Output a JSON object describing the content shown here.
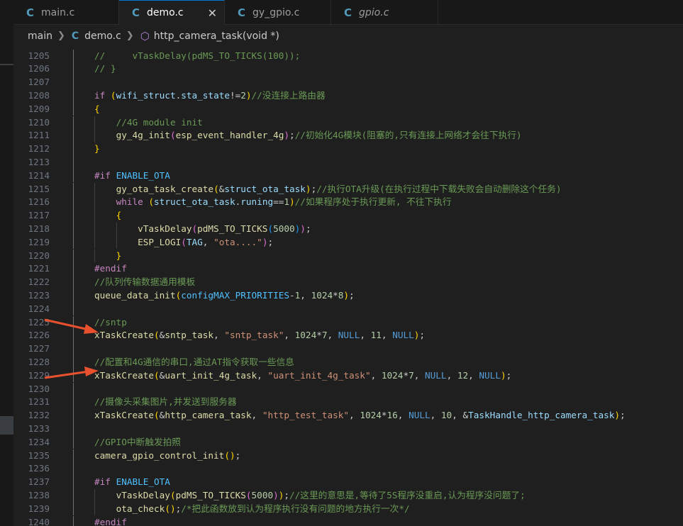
{
  "tabs": [
    {
      "label": "main.c",
      "active": false,
      "italic": false
    },
    {
      "label": "demo.c",
      "active": true,
      "italic": false
    },
    {
      "label": "gy_gpio.c",
      "active": false,
      "italic": false
    },
    {
      "label": "gpio.c",
      "active": false,
      "italic": true
    }
  ],
  "breadcrumb": {
    "folder": "main",
    "file": "demo.c",
    "symbol": "http_camera_task(void *)"
  },
  "icons": {
    "c_file": "C",
    "close": "✕",
    "chevron": "❯",
    "symbol": "⬡"
  },
  "colors": {
    "comment": "#6a9955",
    "keyword": "#569cd6",
    "preprocessor": "#c586c0",
    "function": "#dcdcaa",
    "variable": "#9cdcfe",
    "number": "#b5cea8",
    "string": "#ce9178",
    "macro": "#4fc1ff",
    "annotation_arrow": "#e8502e"
  },
  "code_lines": [
    {
      "num": "1205",
      "tokens": [
        [
          "c",
          "//     vTaskDelay(pdMS_TO_TICKS(100));"
        ]
      ]
    },
    {
      "num": "1206",
      "tokens": [
        [
          "c",
          "// }"
        ]
      ]
    },
    {
      "num": "1207",
      "tokens": []
    },
    {
      "num": "1208",
      "tokens": [
        [
          "p",
          "if"
        ],
        [
          "",
          " "
        ],
        [
          "b1",
          "("
        ],
        [
          "v",
          "wifi_struct"
        ],
        [
          "",
          "."
        ],
        [
          "v",
          "sta_state"
        ],
        [
          "",
          "!="
        ],
        [
          "n",
          "2"
        ],
        [
          "b1",
          ")"
        ],
        [
          "c",
          "//没连接上路由器"
        ]
      ]
    },
    {
      "num": "1209",
      "tokens": [
        [
          "b1",
          "{"
        ]
      ]
    },
    {
      "num": "1210",
      "tokens": [
        [
          "",
          "    "
        ],
        [
          "c",
          "//4G module init"
        ]
      ]
    },
    {
      "num": "1211",
      "tokens": [
        [
          "",
          "    "
        ],
        [
          "f",
          "gy_4g_init"
        ],
        [
          "b2",
          "("
        ],
        [
          "f",
          "esp_event_handler_4g"
        ],
        [
          "b2",
          ")"
        ],
        [
          "",
          ";"
        ],
        [
          "c",
          "//初始化4G模块(阻塞的,只有连接上网络才会往下执行)"
        ]
      ]
    },
    {
      "num": "1212",
      "tokens": [
        [
          "b1",
          "}"
        ]
      ]
    },
    {
      "num": "1213",
      "tokens": []
    },
    {
      "num": "1214",
      "tokens": [
        [
          "p",
          "#if"
        ],
        [
          "",
          " "
        ],
        [
          "m",
          "ENABLE_OTA"
        ]
      ]
    },
    {
      "num": "1215",
      "tokens": [
        [
          "",
          "    "
        ],
        [
          "f",
          "gy_ota_task_create"
        ],
        [
          "b1",
          "("
        ],
        [
          "",
          "&"
        ],
        [
          "v",
          "struct_ota_task"
        ],
        [
          "b1",
          ")"
        ],
        [
          "",
          ";"
        ],
        [
          "c",
          "//执行OTA升级(在执行过程中下载失败会自动删除这个任务)"
        ]
      ]
    },
    {
      "num": "1216",
      "tokens": [
        [
          "",
          "    "
        ],
        [
          "p",
          "while"
        ],
        [
          "",
          " "
        ],
        [
          "b1",
          "("
        ],
        [
          "v",
          "struct_ota_task"
        ],
        [
          "",
          "."
        ],
        [
          "v",
          "runing"
        ],
        [
          "",
          "=="
        ],
        [
          "n",
          "1"
        ],
        [
          "b1",
          ")"
        ],
        [
          "c",
          "//如果程序处于执行更新, 不往下执行"
        ]
      ]
    },
    {
      "num": "1217",
      "tokens": [
        [
          "",
          "    "
        ],
        [
          "b1",
          "{"
        ]
      ]
    },
    {
      "num": "1218",
      "tokens": [
        [
          "",
          "        "
        ],
        [
          "f",
          "vTaskDelay"
        ],
        [
          "b2",
          "("
        ],
        [
          "f",
          "pdMS_TO_TICKS"
        ],
        [
          "b3",
          "("
        ],
        [
          "n",
          "5000"
        ],
        [
          "b3",
          ")"
        ],
        [
          "b2",
          ")"
        ],
        [
          "",
          ";"
        ]
      ]
    },
    {
      "num": "1219",
      "tokens": [
        [
          "",
          "        "
        ],
        [
          "f",
          "ESP_LOGI"
        ],
        [
          "b2",
          "("
        ],
        [
          "v",
          "TAG"
        ],
        [
          "",
          ", "
        ],
        [
          "s",
          "\"ota....\""
        ],
        [
          "b2",
          ")"
        ],
        [
          "",
          ";"
        ]
      ]
    },
    {
      "num": "1220",
      "tokens": [
        [
          "",
          "    "
        ],
        [
          "b1",
          "}"
        ]
      ]
    },
    {
      "num": "1221",
      "tokens": [
        [
          "p",
          "#endif"
        ]
      ]
    },
    {
      "num": "1222",
      "tokens": [
        [
          "c",
          "//队列传输数据通用模板"
        ]
      ]
    },
    {
      "num": "1223",
      "tokens": [
        [
          "f",
          "queue_data_init"
        ],
        [
          "b1",
          "("
        ],
        [
          "m",
          "configMAX_PRIORITIES"
        ],
        [
          "",
          "-"
        ],
        [
          "n",
          "1"
        ],
        [
          "",
          ", "
        ],
        [
          "n",
          "1024"
        ],
        [
          "",
          "*"
        ],
        [
          "n",
          "8"
        ],
        [
          "b1",
          ")"
        ],
        [
          "",
          ";"
        ]
      ]
    },
    {
      "num": "1224",
      "tokens": []
    },
    {
      "num": "1225",
      "tokens": [
        [
          "c",
          "//sntp"
        ]
      ]
    },
    {
      "num": "1226",
      "tokens": [
        [
          "f",
          "xTaskCreate"
        ],
        [
          "b1",
          "("
        ],
        [
          "",
          "&"
        ],
        [
          "f",
          "sntp_task"
        ],
        [
          "",
          ", "
        ],
        [
          "s",
          "\"sntp_task\""
        ],
        [
          "",
          ", "
        ],
        [
          "n",
          "1024"
        ],
        [
          "",
          "*"
        ],
        [
          "n",
          "7"
        ],
        [
          "",
          ", "
        ],
        [
          "k",
          "NULL"
        ],
        [
          "",
          ", "
        ],
        [
          "n",
          "11"
        ],
        [
          "",
          ", "
        ],
        [
          "k",
          "NULL"
        ],
        [
          "b1",
          ")"
        ],
        [
          "",
          ";"
        ]
      ]
    },
    {
      "num": "1227",
      "tokens": []
    },
    {
      "num": "1228",
      "tokens": [
        [
          "c",
          "//配置和4G通信的串口,通过AT指令获取一些信息"
        ]
      ]
    },
    {
      "num": "1229",
      "tokens": [
        [
          "f",
          "xTaskCreate"
        ],
        [
          "b1",
          "("
        ],
        [
          "",
          "&"
        ],
        [
          "f",
          "uart_init_4g_task"
        ],
        [
          "",
          ", "
        ],
        [
          "s",
          "\"uart_init_4g_task\""
        ],
        [
          "",
          ", "
        ],
        [
          "n",
          "1024"
        ],
        [
          "",
          "*"
        ],
        [
          "n",
          "7"
        ],
        [
          "",
          ", "
        ],
        [
          "k",
          "NULL"
        ],
        [
          "",
          ", "
        ],
        [
          "n",
          "12"
        ],
        [
          "",
          ", "
        ],
        [
          "k",
          "NULL"
        ],
        [
          "b1",
          ")"
        ],
        [
          "",
          ";"
        ]
      ]
    },
    {
      "num": "1230",
      "tokens": []
    },
    {
      "num": "1231",
      "tokens": [
        [
          "c",
          "//摄像头采集图片,并发送到服务器"
        ]
      ]
    },
    {
      "num": "1232",
      "tokens": [
        [
          "f",
          "xTaskCreate"
        ],
        [
          "b1",
          "("
        ],
        [
          "",
          "&"
        ],
        [
          "f",
          "http_camera_task"
        ],
        [
          "",
          ", "
        ],
        [
          "s",
          "\"http_test_task\""
        ],
        [
          "",
          ", "
        ],
        [
          "n",
          "1024"
        ],
        [
          "",
          "*"
        ],
        [
          "n",
          "16"
        ],
        [
          "",
          ", "
        ],
        [
          "k",
          "NULL"
        ],
        [
          "",
          ", "
        ],
        [
          "n",
          "10"
        ],
        [
          "",
          ", &"
        ],
        [
          "v",
          "TaskHandle_http_camera_task"
        ],
        [
          "b1",
          ")"
        ],
        [
          "",
          ";"
        ]
      ]
    },
    {
      "num": "1233",
      "tokens": []
    },
    {
      "num": "1234",
      "tokens": [
        [
          "c",
          "//GPIO中断触发拍照"
        ]
      ]
    },
    {
      "num": "1235",
      "tokens": [
        [
          "f",
          "camera_gpio_control_init"
        ],
        [
          "b1",
          "("
        ],
        [
          "b1",
          ")"
        ],
        [
          "",
          ";"
        ]
      ]
    },
    {
      "num": "1236",
      "tokens": []
    },
    {
      "num": "1237",
      "tokens": [
        [
          "p",
          "#if"
        ],
        [
          "",
          " "
        ],
        [
          "m",
          "ENABLE_OTA"
        ]
      ]
    },
    {
      "num": "1238",
      "tokens": [
        [
          "",
          "    "
        ],
        [
          "f",
          "vTaskDelay"
        ],
        [
          "b1",
          "("
        ],
        [
          "f",
          "pdMS_TO_TICKS"
        ],
        [
          "b2",
          "("
        ],
        [
          "n",
          "5000"
        ],
        [
          "b2",
          ")"
        ],
        [
          "b1",
          ")"
        ],
        [
          "",
          ";"
        ],
        [
          "c",
          "//这里的意思是,等待了5S程序没重启,认为程序没问题了;"
        ]
      ]
    },
    {
      "num": "1239",
      "tokens": [
        [
          "",
          "    "
        ],
        [
          "f",
          "ota_check"
        ],
        [
          "b1",
          "("
        ],
        [
          "b1",
          ")"
        ],
        [
          "",
          ";"
        ],
        [
          "c",
          "/*把此函数放到认为程序执行没有问题的地方执行一次*/"
        ]
      ]
    },
    {
      "num": "1240",
      "tokens": [
        [
          "p",
          "#endif"
        ]
      ]
    }
  ]
}
